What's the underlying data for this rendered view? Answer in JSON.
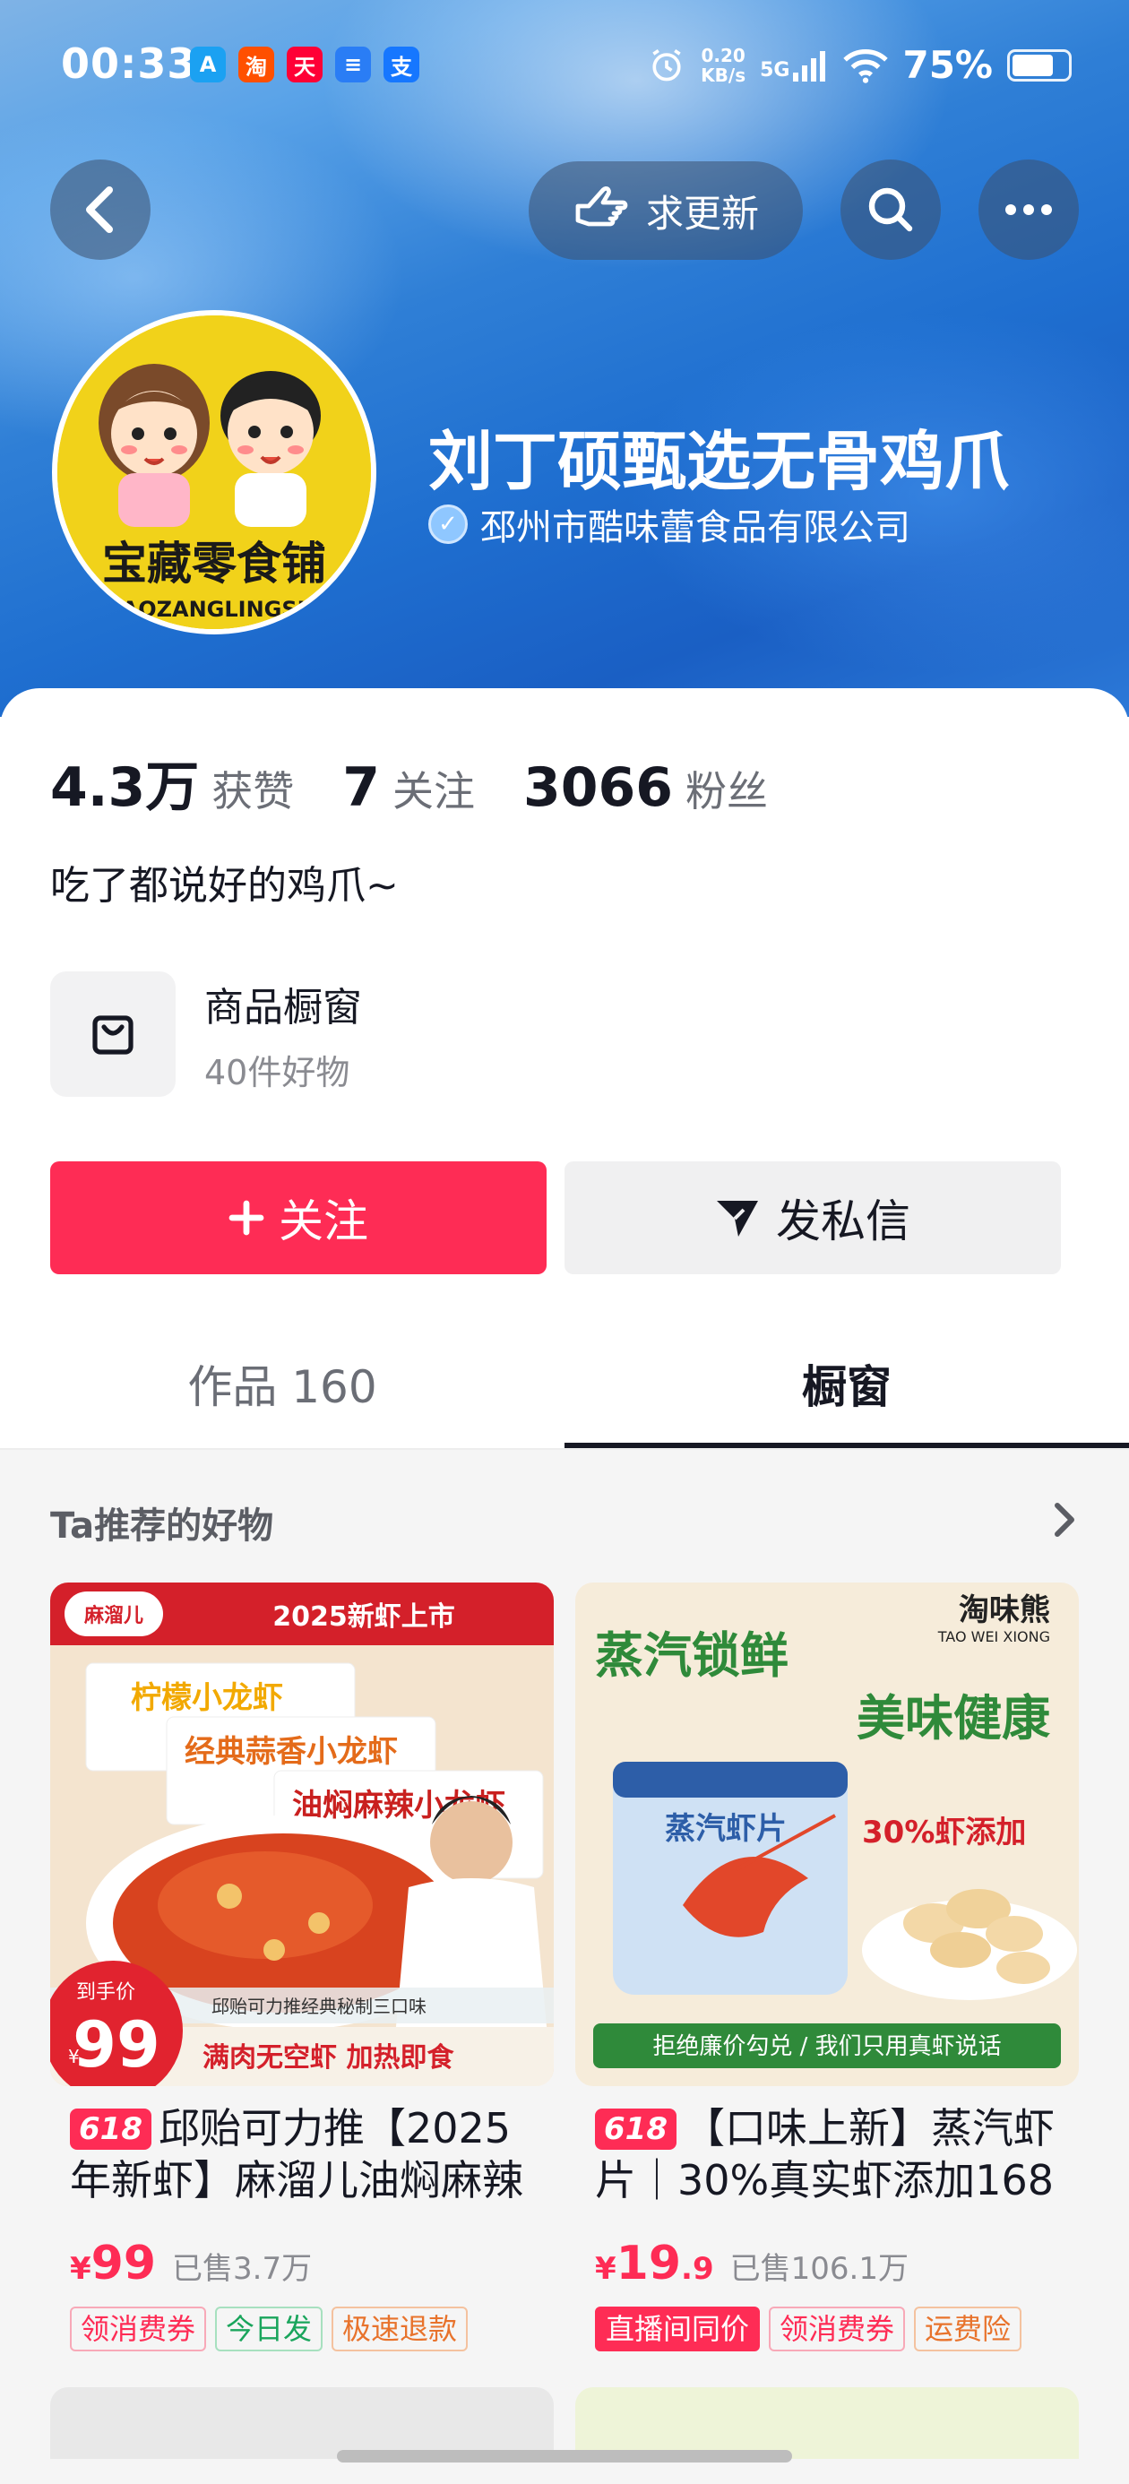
{
  "status_bar": {
    "time": "00:33",
    "app_icons": [
      {
        "glyph": "A",
        "color": "#1ba1f2"
      },
      {
        "glyph": "淘",
        "color": "#ff5000"
      },
      {
        "glyph": "天",
        "color": "#ff0036"
      },
      {
        "glyph": "≡",
        "color": "#2a7df5"
      },
      {
        "glyph": "支",
        "color": "#1677ff"
      }
    ],
    "speed_top": "0.20",
    "speed_bottom": "KB/s",
    "network": "5G",
    "battery": "75%",
    "battery_level": 0.75
  },
  "nav": {
    "request_update": "求更新"
  },
  "profile": {
    "name": "刘丁硕甄选无骨鸡爪",
    "company": "邳州市酷味蕾食品有限公司",
    "avatar_text": "宝藏零食铺",
    "avatar_sub": "BAOZANGLINGSHI",
    "stats": [
      {
        "num": "4.3万",
        "label": "获赞"
      },
      {
        "num": "7",
        "label": "关注"
      },
      {
        "num": "3066",
        "label": "粉丝"
      }
    ],
    "bio": "吃了都说好的鸡爪~"
  },
  "showcase": {
    "title": "商品橱窗",
    "count": "40件好物"
  },
  "actions": {
    "follow": "关注",
    "message": "发私信"
  },
  "tabs": [
    {
      "label": "作品 160"
    },
    {
      "label": "橱窗"
    }
  ],
  "recommend": {
    "title": "Ta推荐的好物"
  },
  "products": [
    {
      "promo": "618",
      "title": "邱贻可力推【2025年新虾】麻溜儿油焖麻辣",
      "price_symbol": "¥",
      "price": "99",
      "price_decimal": "",
      "sold": "已售3.7万",
      "badges": [
        "领消费券",
        "今日发",
        "极速退款"
      ],
      "img_banner": "2025新虾上市",
      "img_price_label": "到手价",
      "img_price": "99",
      "img_bottom": "满肉无空虾 加热即食"
    },
    {
      "promo": "618",
      "title": "【口味上新】蒸汽虾片｜30%真实虾添加168",
      "price_symbol": "¥",
      "price": "19",
      "price_decimal": ".9",
      "sold": "已售106.1万",
      "badges": [
        "直播间同价",
        "领消费券",
        "运费险"
      ],
      "img_brand": "淘味熊",
      "img_brand_en": "TAO WEI XIONG",
      "img_line1": "蒸汽锁鲜",
      "img_line2": "美味健康",
      "img_pct": "30%虾添加",
      "img_bottom": "拒绝廉价勾兑 / 我们只用真虾说话"
    }
  ]
}
